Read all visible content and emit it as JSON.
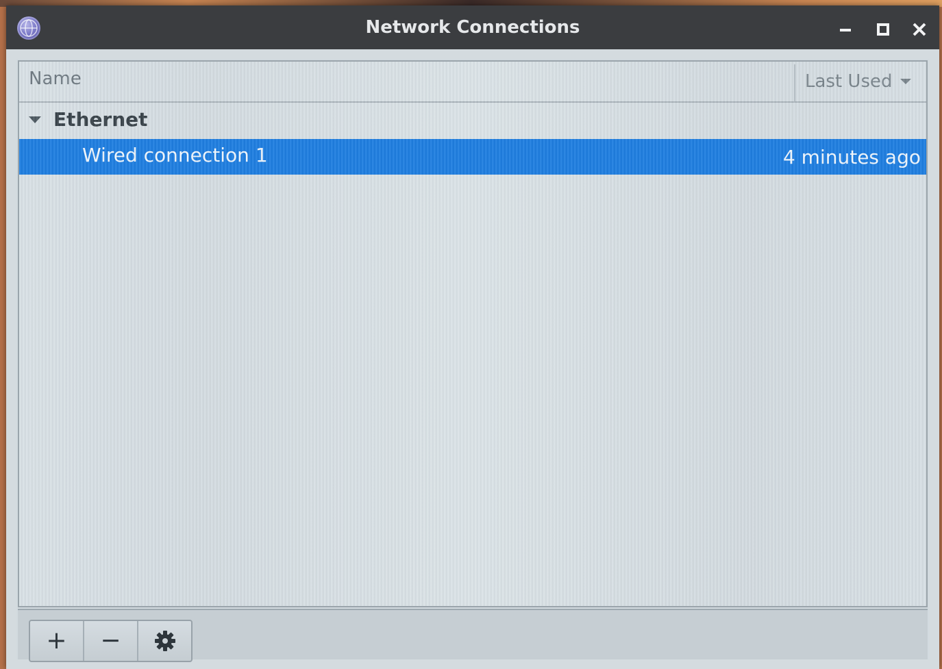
{
  "window": {
    "title": "Network Connections",
    "icons": {
      "app": "network-globe-icon",
      "minimize": "minimize-icon",
      "maximize": "maximize-icon",
      "close": "close-icon"
    }
  },
  "table": {
    "columns": {
      "name": "Name",
      "last_used": "Last Used"
    },
    "sort_indicator": "chevron-down-icon",
    "groups": [
      {
        "label": "Ethernet",
        "expanded": true,
        "connections": [
          {
            "name": "Wired connection 1",
            "last_used": "4 minutes ago",
            "selected": true
          }
        ]
      }
    ]
  },
  "toolbar": {
    "add_label": "+",
    "remove_label": "−",
    "settings_icon": "gear-icon"
  },
  "colors": {
    "titlebar": "#3b3d40",
    "selection": "#1f7ee0",
    "background": "#d4dbdf"
  }
}
